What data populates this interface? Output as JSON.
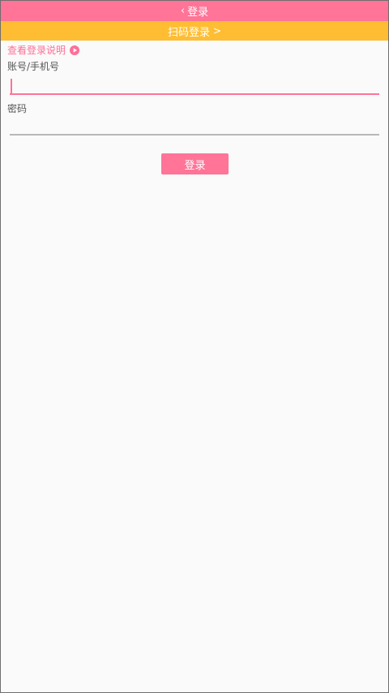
{
  "header": {
    "back_chevron": "‹",
    "title": "登录"
  },
  "qr_bar": {
    "label": "扫码登录",
    "chevron": ">"
  },
  "help": {
    "label": "查看登录说明",
    "icon": "play-circle-icon"
  },
  "form": {
    "account_label": "账号/手机号",
    "account_value": "",
    "password_label": "密码",
    "password_value": "",
    "submit_label": "登录"
  },
  "colors": {
    "primary_pink": "#ff7497",
    "qr_bar_yellow": "#ffbd33",
    "background": "#fafafa",
    "inactive_underline": "#b8b8b8"
  }
}
